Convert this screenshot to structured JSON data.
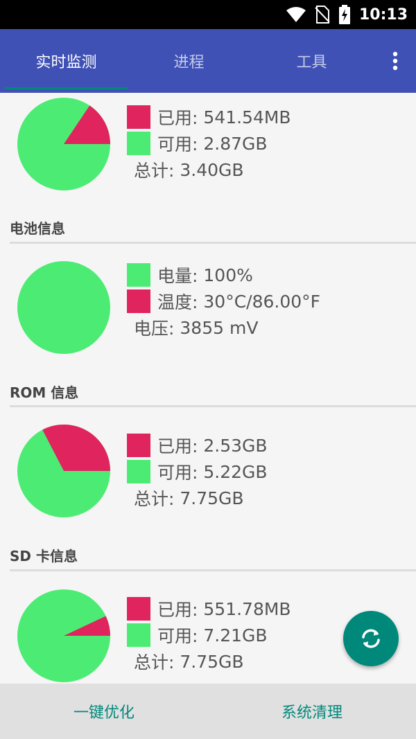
{
  "status_bar": {
    "time": "10:13"
  },
  "tabs": [
    {
      "label": "实时监测",
      "active": true
    },
    {
      "label": "进程",
      "active": false
    },
    {
      "label": "工具",
      "active": false
    }
  ],
  "colors": {
    "used": "#e0245e",
    "free": "#4cec74",
    "primary": "#3f51b5",
    "accent": "#00897b"
  },
  "memory": {
    "used_label": "已用:",
    "used_value": "541.54MB",
    "free_label": "可用:",
    "free_value": "2.87GB",
    "total_label": "总计:",
    "total_value": "3.40GB",
    "used_fraction": 0.156
  },
  "battery": {
    "title": "电池信息",
    "level_label": "电量:",
    "level_value": "100%",
    "temp_label": "温度:",
    "temp_value": "30°C/86.00°F",
    "voltage_label": "电压:",
    "voltage_value": "3855 mV",
    "level_fraction": 1.0
  },
  "rom": {
    "title": "ROM 信息",
    "used_label": "已用:",
    "used_value": "2.53GB",
    "free_label": "可用:",
    "free_value": "5.22GB",
    "total_label": "总计:",
    "total_value": "7.75GB",
    "used_fraction": 0.326
  },
  "sd": {
    "title": "SD 卡信息",
    "used_label": "已用:",
    "used_value": "551.78MB",
    "free_label": "可用:",
    "free_value": "7.21GB",
    "total_label": "总计:",
    "total_value": "7.75GB",
    "used_fraction": 0.07
  },
  "bottom": {
    "optimize_label": "一键优化",
    "clean_label": "系统清理"
  },
  "icons": {
    "fab": "refresh-icon",
    "menu": "more-vert-icon"
  }
}
